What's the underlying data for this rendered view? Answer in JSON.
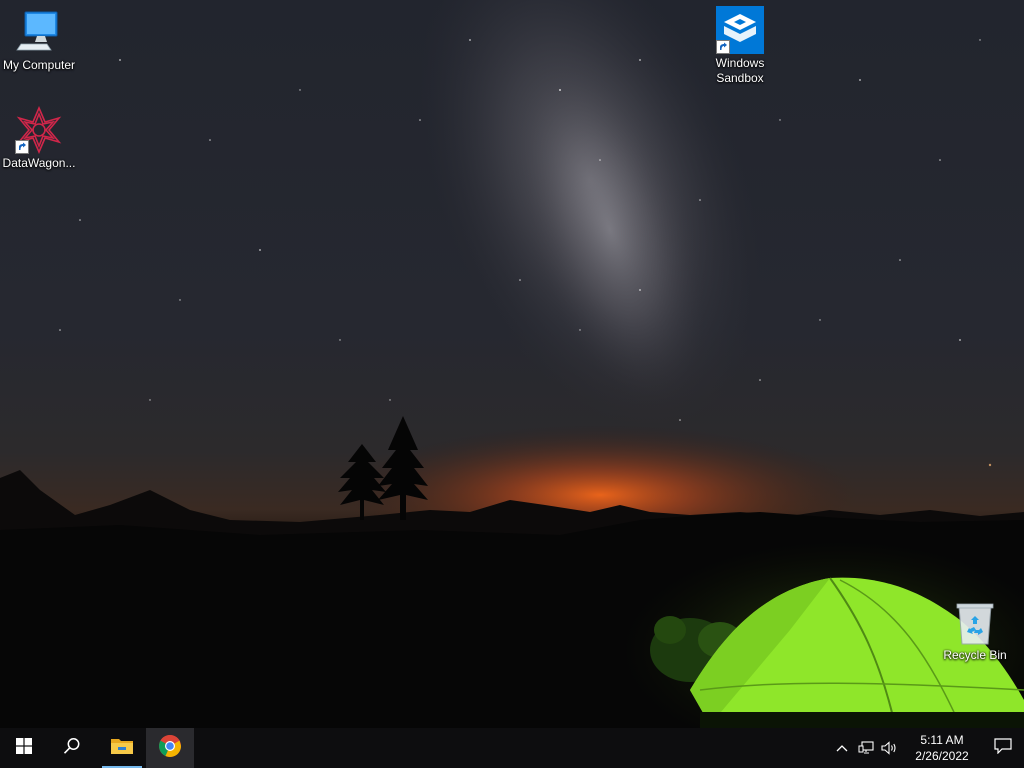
{
  "desktop": {
    "icons": [
      {
        "label": "My Computer",
        "icon": "computer-icon"
      },
      {
        "label": "DataWagon...",
        "icon": "datawagon-icon"
      },
      {
        "label": "Windows Sandbox",
        "icon": "windows-sandbox-icon"
      },
      {
        "label": "Recycle Bin",
        "icon": "recycle-bin-icon"
      }
    ]
  },
  "taskbar": {
    "start_icon": "windows-logo-icon",
    "search_icon": "search-icon",
    "pinned": [
      {
        "name": "File Explorer",
        "icon": "folder-icon",
        "underline": true
      },
      {
        "name": "Google Chrome",
        "icon": "chrome-icon",
        "active": true
      }
    ],
    "tray": {
      "icons": [
        "chevron-up-icon",
        "network-icon",
        "volume-icon"
      ],
      "time": "5:11 AM",
      "date": "2/26/2022",
      "notification_icon": "notification-icon"
    }
  },
  "colors": {
    "taskbar_bg": "#0d0d0f",
    "accent": "#76b9ed",
    "tent_green": "#8fe62a"
  }
}
